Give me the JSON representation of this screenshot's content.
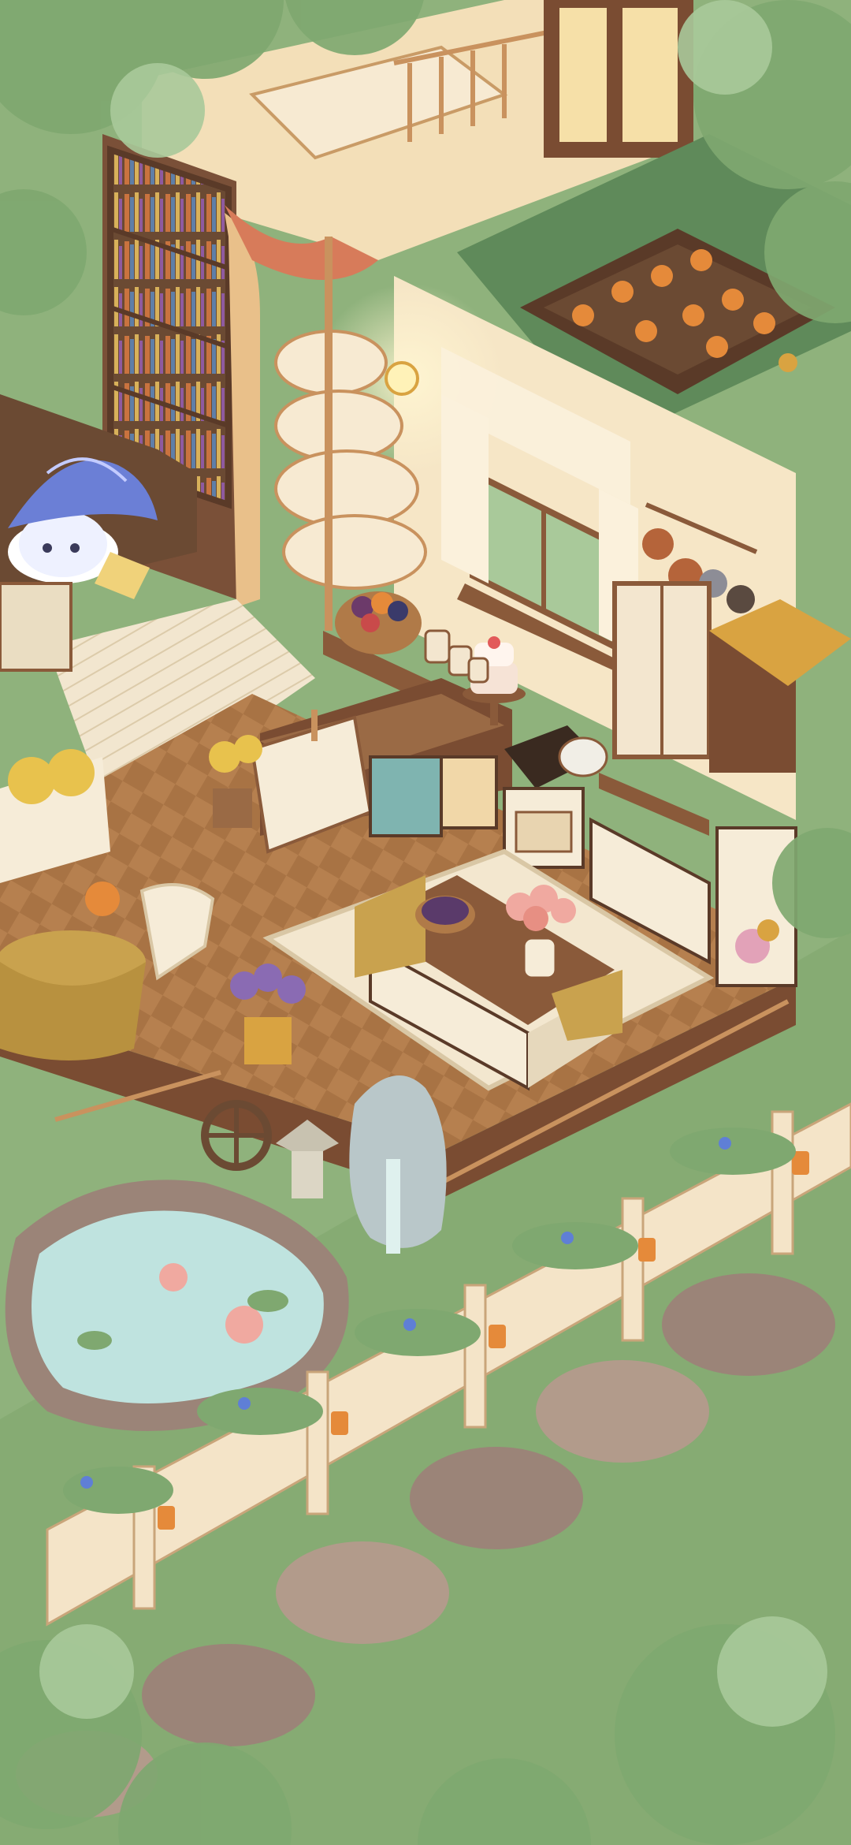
{
  "scene": {
    "title": "",
    "palette": {
      "grass": "#8fb27c",
      "grass_dark": "#6e9a66",
      "wood": "#8a5a3a",
      "wood_light": "#c9925e",
      "wall": "#f6e6c6",
      "floor_a": "#b6804f",
      "floor_b": "#a87344",
      "rug": "#f3e7cf",
      "pond": "#bfe3df",
      "stone": "#9b8478",
      "fence": "#f4e4c8",
      "foliage": "#7fa870",
      "foliage_light": "#a9c99a",
      "accent_orange": "#e58a3a",
      "accent_pink": "#f0a9a0",
      "lavender": "#8a6bb3",
      "witch_hat": "#6b7fd6"
    },
    "objects": {
      "witch_character": "witch-character",
      "bookshelf": "bookshelf",
      "spiral_staircase": "spiral-staircase",
      "curtain": "curtain",
      "kitchen_window": "kitchen-window",
      "hanging_pots": "hanging-pots",
      "cake": "cake",
      "fruit_basket": "fruit-basket",
      "kitchen_island": "kitchen-island",
      "flower_vase": "flower-vase",
      "stove": "stove",
      "cabinet": "cabinet",
      "fridge": "fridge",
      "dining_table": "dining-table",
      "chair": "chair",
      "lavender_pot": "lavender-pot",
      "water_wheel": "water-wheel",
      "pond": "pond",
      "rock_fountain": "rock-fountain",
      "fence": "garden-fence",
      "lanterns": "lantern",
      "stepping_stones": "stepping-stone",
      "flower_planter": "flower-planter"
    }
  }
}
